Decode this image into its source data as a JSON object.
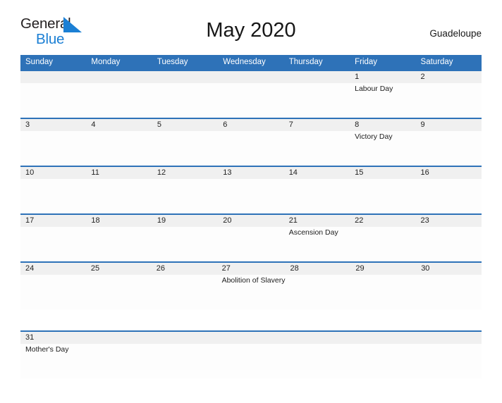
{
  "brand": {
    "name_part1": "General",
    "name_part2": "Blue"
  },
  "header": {
    "title": "May 2020",
    "country": "Guadeloupe"
  },
  "colors": {
    "header_blue": "#2e72b8",
    "brand_blue": "#1b7fd4",
    "date_band": "#f0f0f0",
    "body": "#fdfdfd"
  },
  "calendar": {
    "weekdays": [
      "Sunday",
      "Monday",
      "Tuesday",
      "Wednesday",
      "Thursday",
      "Friday",
      "Saturday"
    ],
    "weeks": [
      [
        {
          "num": "",
          "event": ""
        },
        {
          "num": "",
          "event": ""
        },
        {
          "num": "",
          "event": ""
        },
        {
          "num": "",
          "event": ""
        },
        {
          "num": "",
          "event": ""
        },
        {
          "num": "1",
          "event": "Labour Day"
        },
        {
          "num": "2",
          "event": ""
        }
      ],
      [
        {
          "num": "3",
          "event": ""
        },
        {
          "num": "4",
          "event": ""
        },
        {
          "num": "5",
          "event": ""
        },
        {
          "num": "6",
          "event": ""
        },
        {
          "num": "7",
          "event": ""
        },
        {
          "num": "8",
          "event": "Victory Day"
        },
        {
          "num": "9",
          "event": ""
        }
      ],
      [
        {
          "num": "10",
          "event": ""
        },
        {
          "num": "11",
          "event": ""
        },
        {
          "num": "12",
          "event": ""
        },
        {
          "num": "13",
          "event": ""
        },
        {
          "num": "14",
          "event": ""
        },
        {
          "num": "15",
          "event": ""
        },
        {
          "num": "16",
          "event": ""
        }
      ],
      [
        {
          "num": "17",
          "event": ""
        },
        {
          "num": "18",
          "event": ""
        },
        {
          "num": "19",
          "event": ""
        },
        {
          "num": "20",
          "event": ""
        },
        {
          "num": "21",
          "event": "Ascension Day"
        },
        {
          "num": "22",
          "event": ""
        },
        {
          "num": "23",
          "event": ""
        }
      ],
      [
        {
          "num": "24",
          "event": ""
        },
        {
          "num": "25",
          "event": ""
        },
        {
          "num": "26",
          "event": ""
        },
        {
          "num": "27",
          "event": "Abolition of Slavery"
        },
        {
          "num": "28",
          "event": ""
        },
        {
          "num": "29",
          "event": ""
        },
        {
          "num": "30",
          "event": ""
        }
      ],
      [
        {
          "num": "31",
          "event": "Mother's Day"
        },
        {
          "num": "",
          "event": ""
        },
        {
          "num": "",
          "event": ""
        },
        {
          "num": "",
          "event": ""
        },
        {
          "num": "",
          "event": ""
        },
        {
          "num": "",
          "event": ""
        },
        {
          "num": "",
          "event": ""
        }
      ]
    ]
  }
}
